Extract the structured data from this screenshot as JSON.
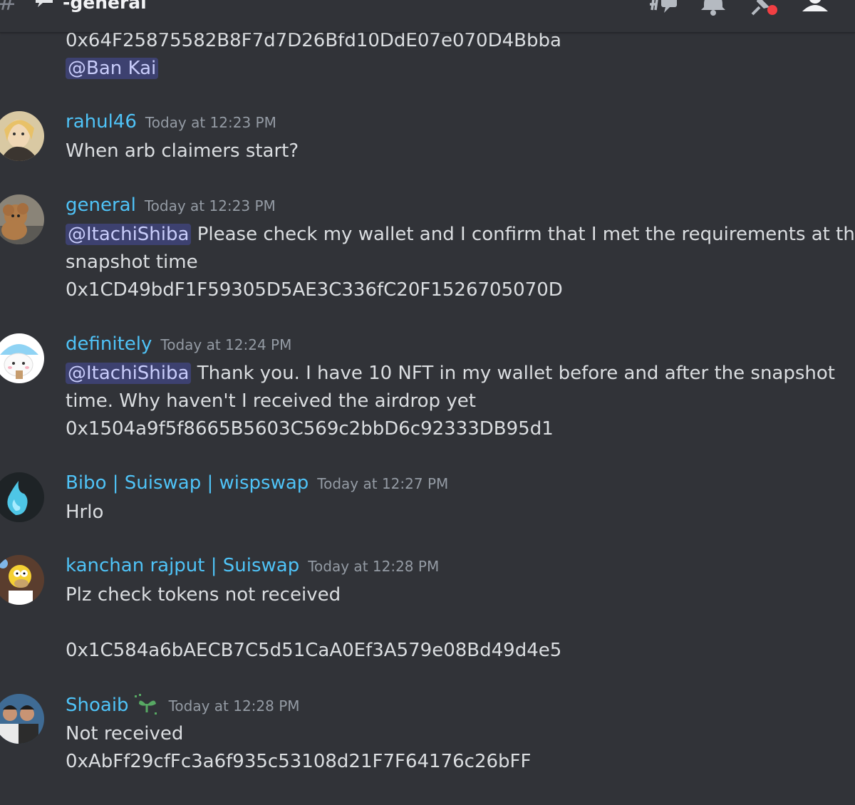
{
  "header": {
    "channel_hash": "#",
    "channel_name": "-general",
    "icons": [
      "threads-icon",
      "bell-icon",
      "pin-icon",
      "member-list-icon"
    ],
    "notification_dot_color": "#f23f43"
  },
  "colors": {
    "background": "#313338",
    "username": "#4fc3f7",
    "timestamp": "#949ba4",
    "text": "#dbdee1"
  },
  "messages": [
    {
      "lines": [
        {
          "text": "0x64F25875582B8F7d7D26Bfd10DdE07e070D4Bbba"
        },
        {
          "mention": "@Ban Kai"
        }
      ]
    },
    {
      "username": "rahul46",
      "timestamp": "Today at 12:23 PM",
      "lines": [
        {
          "text": "When arb claimers start?"
        }
      ]
    },
    {
      "username": "general",
      "timestamp": "Today at 12:23 PM",
      "lines": [
        {
          "mention": "@ItachiShiba",
          "text": " Please check my wallet and I confirm that I met the requirements at the"
        },
        {
          "text": "snapshot time"
        },
        {
          "text": "0x1CD49bdF1F59305D5AE3C336fC20F1526705070D"
        }
      ]
    },
    {
      "username": "definitely",
      "timestamp": "Today at 12:24 PM",
      "lines": [
        {
          "mention": "@ItachiShiba",
          "text": " Thank you. I have 10 NFT in my wallet before and after the snapshot"
        },
        {
          "text": "time. Why haven't I received the airdrop yet"
        },
        {
          "text": "0x1504a9f5f8665B5603C569c2bbD6c92333DB95d1"
        }
      ]
    },
    {
      "username": "Bibo | Suiswap | wispswap",
      "timestamp": "Today at 12:27 PM",
      "lines": [
        {
          "text": "Hrlo"
        }
      ]
    },
    {
      "username": "kanchan rajput | Suiswap",
      "timestamp": "Today at 12:28 PM",
      "lines": [
        {
          "text": "Plz check tokens not received"
        },
        {
          "text": ""
        },
        {
          "text": "0x1C584a6bAECB7C5d51CaA0Ef3A579e08Bd49d4e5"
        }
      ]
    },
    {
      "username": "Shoaib",
      "timestamp": "Today at 12:28 PM",
      "badge_icon": "sprout-badge-icon",
      "lines": [
        {
          "text": "Not received"
        },
        {
          "text": "0xAbFf29cfFc3a6f935c53108d21F7F64176c26bFF"
        }
      ]
    }
  ]
}
